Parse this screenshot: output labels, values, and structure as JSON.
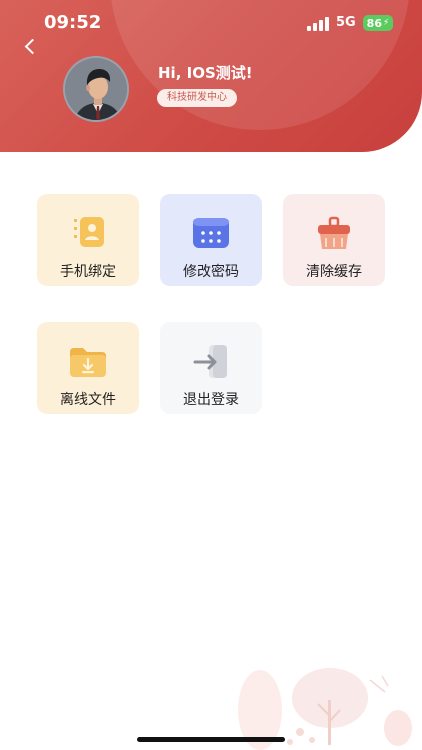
{
  "status_bar": {
    "time": "09:52",
    "network": "5G",
    "battery": "86"
  },
  "header": {
    "greeting": "Hi, IOS测试!",
    "department": "科技研发中心",
    "back_icon": "chevron-left-icon",
    "accent_color": "#cf4b46"
  },
  "menu": {
    "items": [
      {
        "label": "手机绑定",
        "icon": "phone-contact-icon"
      },
      {
        "label": "修改密码",
        "icon": "password-keypad-icon"
      },
      {
        "label": "清除缓存",
        "icon": "clear-cache-icon"
      },
      {
        "label": "离线文件",
        "icon": "download-folder-icon"
      },
      {
        "label": "退出登录",
        "icon": "logout-icon"
      }
    ]
  }
}
